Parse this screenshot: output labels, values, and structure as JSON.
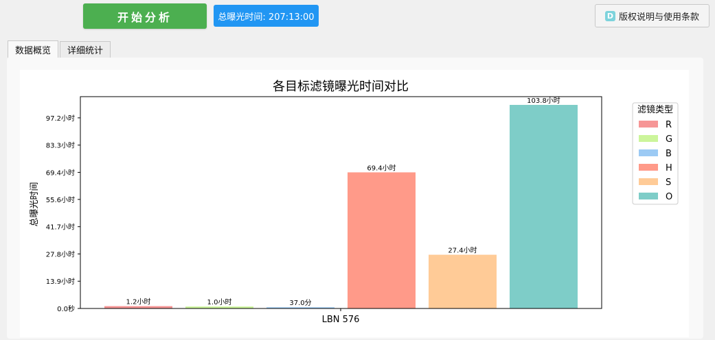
{
  "toolbar": {
    "start_label": "开始分析",
    "total_exposure": "总曝光时间: 207:13:00",
    "license_icon": "D",
    "license_label": "版权说明与使用条款"
  },
  "tabs": [
    {
      "label": "数据概览",
      "active": true
    },
    {
      "label": "详细统计",
      "active": false
    }
  ],
  "chart_data": {
    "type": "bar",
    "title": "各目标滤镜曝光时间对比",
    "ylabel": "总曝光时间",
    "xlabel": "",
    "categories": [
      "LBN 576"
    ],
    "ylim": [
      0,
      108
    ],
    "yticks": [
      {
        "value": 0,
        "label": "0.0秒"
      },
      {
        "value": 13.9,
        "label": "13.9小时"
      },
      {
        "value": 27.8,
        "label": "27.8小时"
      },
      {
        "value": 41.7,
        "label": "41.7小时"
      },
      {
        "value": 55.6,
        "label": "55.6小时"
      },
      {
        "value": 69.4,
        "label": "69.4小时"
      },
      {
        "value": 83.3,
        "label": "83.3小时"
      },
      {
        "value": 97.2,
        "label": "97.2小时"
      }
    ],
    "series": [
      {
        "name": "R",
        "values": [
          1.2
        ],
        "label": "1.2小时",
        "color": "#f69696"
      },
      {
        "name": "G",
        "values": [
          1.0
        ],
        "label": "1.0小时",
        "color": "#ccf59b"
      },
      {
        "name": "B",
        "values": [
          0.62
        ],
        "label": "37.0分",
        "color": "#9ccaf4"
      },
      {
        "name": "H",
        "values": [
          69.4
        ],
        "label": "69.4小时",
        "color": "#ff9a89"
      },
      {
        "name": "S",
        "values": [
          27.4
        ],
        "label": "27.4小时",
        "color": "#ffcb97"
      },
      {
        "name": "O",
        "values": [
          103.8
        ],
        "label": "103.8小时",
        "color": "#7ecdc8"
      }
    ],
    "legend": {
      "title": "滤镜类型",
      "placement": "right"
    },
    "grid": false
  }
}
